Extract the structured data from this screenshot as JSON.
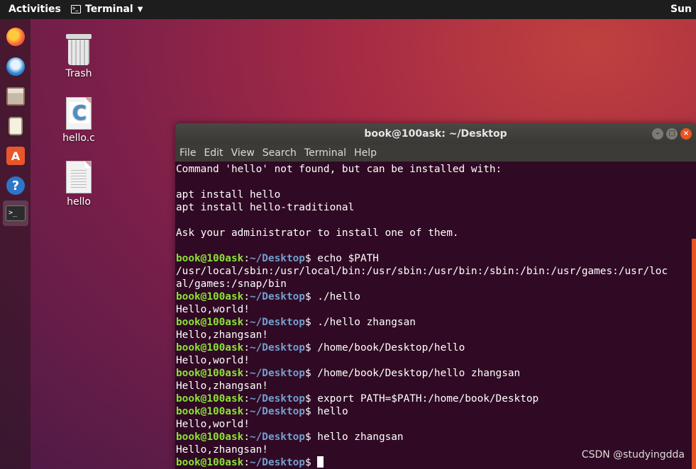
{
  "topbar": {
    "activities": "Activities",
    "app_name": "Terminal",
    "clock": "Sun"
  },
  "dock": {
    "items": [
      "firefox-icon",
      "thunderbird-icon",
      "files-icon",
      "rhythmbox-icon",
      "software-icon",
      "help-icon",
      "terminal-icon"
    ],
    "store_glyph": "A",
    "help_glyph": "?",
    "term_glyph": ">_"
  },
  "desktop": {
    "icons": [
      {
        "label": "Trash"
      },
      {
        "label": "hello.c"
      },
      {
        "label": "hello"
      }
    ]
  },
  "terminal": {
    "title": "book@100ask: ~/Desktop",
    "menu": [
      "File",
      "Edit",
      "View",
      "Search",
      "Terminal",
      "Help"
    ],
    "prompt_user": "book@100ask",
    "prompt_path": "~/Desktop",
    "lines": [
      {
        "type": "out",
        "text": "Command 'hello' not found, but can be installed with:"
      },
      {
        "type": "out",
        "text": ""
      },
      {
        "type": "out",
        "text": "apt install hello"
      },
      {
        "type": "out",
        "text": "apt install hello-traditional"
      },
      {
        "type": "out",
        "text": ""
      },
      {
        "type": "out",
        "text": "Ask your administrator to install one of them."
      },
      {
        "type": "out",
        "text": ""
      },
      {
        "type": "cmd",
        "text": " echo $PATH"
      },
      {
        "type": "out",
        "text": "/usr/local/sbin:/usr/local/bin:/usr/sbin:/usr/bin:/sbin:/bin:/usr/games:/usr/loc"
      },
      {
        "type": "out",
        "text": "al/games:/snap/bin"
      },
      {
        "type": "cmd",
        "text": " ./hello"
      },
      {
        "type": "out",
        "text": "Hello,world!"
      },
      {
        "type": "cmd",
        "text": " ./hello zhangsan"
      },
      {
        "type": "out",
        "text": "Hello,zhangsan!"
      },
      {
        "type": "cmd",
        "text": " /home/book/Desktop/hello"
      },
      {
        "type": "out",
        "text": "Hello,world!"
      },
      {
        "type": "cmd",
        "text": " /home/book/Desktop/hello zhangsan"
      },
      {
        "type": "out",
        "text": "Hello,zhangsan!"
      },
      {
        "type": "cmd",
        "text": " export PATH=$PATH:/home/book/Desktop"
      },
      {
        "type": "cmd",
        "text": " hello"
      },
      {
        "type": "out",
        "text": "Hello,world!"
      },
      {
        "type": "cmd",
        "text": " hello zhangsan"
      },
      {
        "type": "out",
        "text": "Hello,zhangsan!"
      },
      {
        "type": "cursor",
        "text": " "
      }
    ]
  },
  "watermark": "CSDN @studyingdda"
}
